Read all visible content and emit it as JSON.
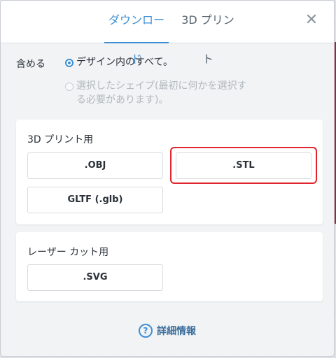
{
  "tabs": [
    {
      "label": "ダウンロード",
      "active": true
    },
    {
      "label": "3D プリント",
      "active": false
    }
  ],
  "close_icon": "close-icon",
  "include": {
    "label": "含める",
    "options": [
      {
        "label": "デザイン内のすべて。",
        "selected": true,
        "enabled": true
      },
      {
        "line1": "選択したシェイプ(最初に何かを選択す",
        "line2": "る必要があります)。",
        "selected": false,
        "enabled": false
      }
    ]
  },
  "print_section": {
    "title": "3D プリント用",
    "buttons": [
      ".OBJ",
      ".STL",
      "GLTF (.glb)"
    ],
    "highlighted": ".STL"
  },
  "laser_section": {
    "title": "レーザー カット用",
    "buttons": [
      ".SVG"
    ]
  },
  "more_info": {
    "label": "詳細情報",
    "icon": "help-icon"
  },
  "colors": {
    "accent": "#3d8fd4",
    "highlight": "#e0252e",
    "background_shape": "#9c2836"
  }
}
